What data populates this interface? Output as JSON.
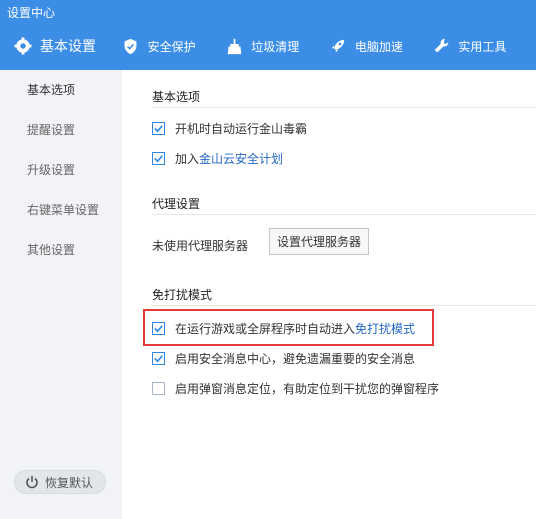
{
  "window": {
    "title": "设置中心"
  },
  "tabs": [
    {
      "label": "基本设置",
      "icon": "gear-icon",
      "active": true
    },
    {
      "label": "安全保护",
      "icon": "shield-icon"
    },
    {
      "label": "垃圾清理",
      "icon": "broom-icon"
    },
    {
      "label": "电脑加速",
      "icon": "rocket-icon"
    },
    {
      "label": "实用工具",
      "icon": "wrench-icon"
    }
  ],
  "sidebar": {
    "items": [
      {
        "label": "基本选项",
        "active": true
      },
      {
        "label": "提醒设置"
      },
      {
        "label": "升级设置"
      },
      {
        "label": "右键菜单设置"
      },
      {
        "label": "其他设置"
      }
    ],
    "restore_label": "恢复默认"
  },
  "sections": {
    "basic": {
      "title": "基本选项",
      "opt1": "开机时自动运行金山毒霸",
      "opt2_prefix": "加入 ",
      "opt2_link": "金山云安全计划"
    },
    "proxy": {
      "title": "代理设置",
      "status": "未使用代理服务器",
      "button": "设置代理服务器"
    },
    "dnd": {
      "title": "免打扰模式",
      "opt1_prefix": "在运行游戏或全屏程序时自动进入 ",
      "opt1_link": "免打扰模式",
      "opt2": "启用安全消息中心，避免遗漏重要的安全消息",
      "opt3": "启用弹窗消息定位，有助定位到干扰您的弹窗程序"
    }
  },
  "colors": {
    "accent": "#3b8de6",
    "highlight": "#e23a3a",
    "link": "#2366c4"
  }
}
